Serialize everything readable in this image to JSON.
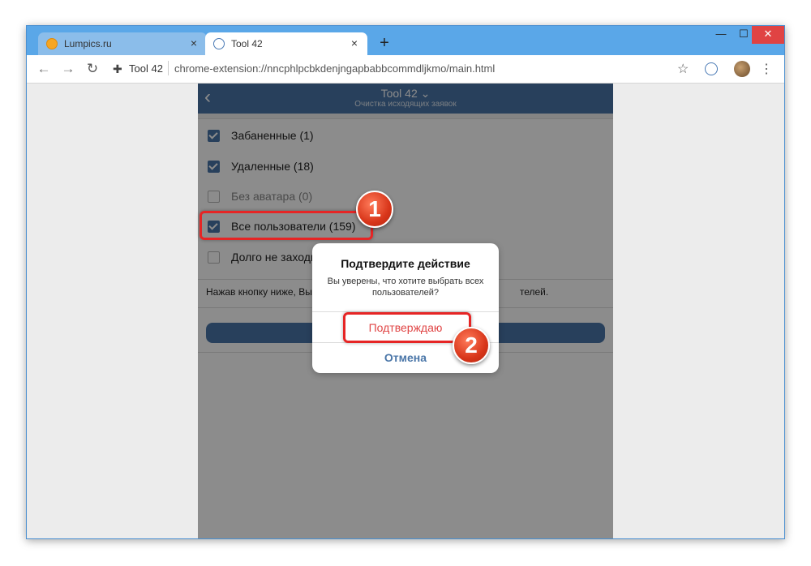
{
  "browser": {
    "tabs": [
      {
        "title": "Lumpics.ru",
        "close": "×"
      },
      {
        "title": "Tool 42",
        "close": "×"
      }
    ],
    "new_tab": "+",
    "window_controls": {
      "minimize": "—",
      "maximize": "☐",
      "close": "✕"
    },
    "nav": {
      "back": "←",
      "forward": "→",
      "reload": "↻"
    },
    "omnibox": {
      "site": "Tool 42",
      "url": "chrome-extension://nncphlpcbkdenjngapbabbcommdljkmo/main.html"
    },
    "toolbar_icons": {
      "star": "☆",
      "menu": "⋮"
    }
  },
  "app": {
    "back": "‹",
    "title": "Tool 42 ⌄",
    "subtitle": "Очистка исходящих заявок",
    "options": [
      {
        "label": "Забаненные (1)",
        "checked": true
      },
      {
        "label": "Удаленные (18)",
        "checked": true
      },
      {
        "label": "Без аватара (0)",
        "checked": false
      },
      {
        "label": "Все пользователи (159)",
        "checked": true
      },
      {
        "label": "Долго не заходи",
        "checked": false
      }
    ],
    "note_start": "Нажав кнопку ниже, Вы",
    "note_end": "телей."
  },
  "dialog": {
    "title": "Подтвердите действие",
    "message": "Вы уверены, что хотите выбрать всех пользователей?",
    "confirm": "Подтверждаю",
    "cancel": "Отмена"
  },
  "annotations": {
    "step1": "1",
    "step2": "2"
  },
  "colors": {
    "window_frame": "#5aa7e8",
    "app_header": "#4a76a8",
    "checkbox_checked": "#4a76a8",
    "highlight": "#e62525",
    "confirm_text": "#e04444",
    "badge": "#d8361a"
  }
}
